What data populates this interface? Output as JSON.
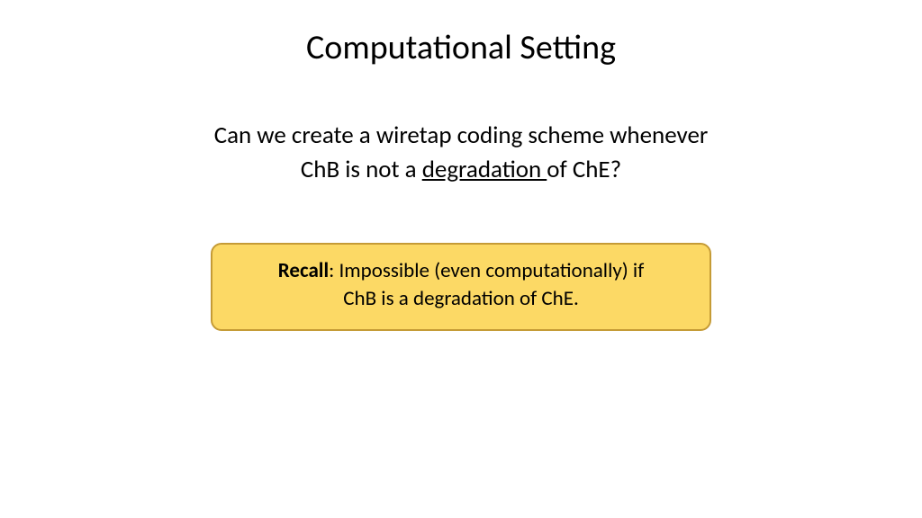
{
  "slide": {
    "title": "Computational Setting",
    "question_line1": "Can we create a wiretap coding scheme whenever",
    "question_line2_pre": "ChB is not a ",
    "question_line2_underlined": "degradation ",
    "question_line2_post": "of ChE?",
    "callout": {
      "bold_label": "Recall",
      "line1_rest": ": Impossible (even computationally) if",
      "line2": "ChB is a degradation of ChE."
    }
  },
  "colors": {
    "callout_bg": "#fcd965",
    "callout_border": "#c59b36"
  }
}
